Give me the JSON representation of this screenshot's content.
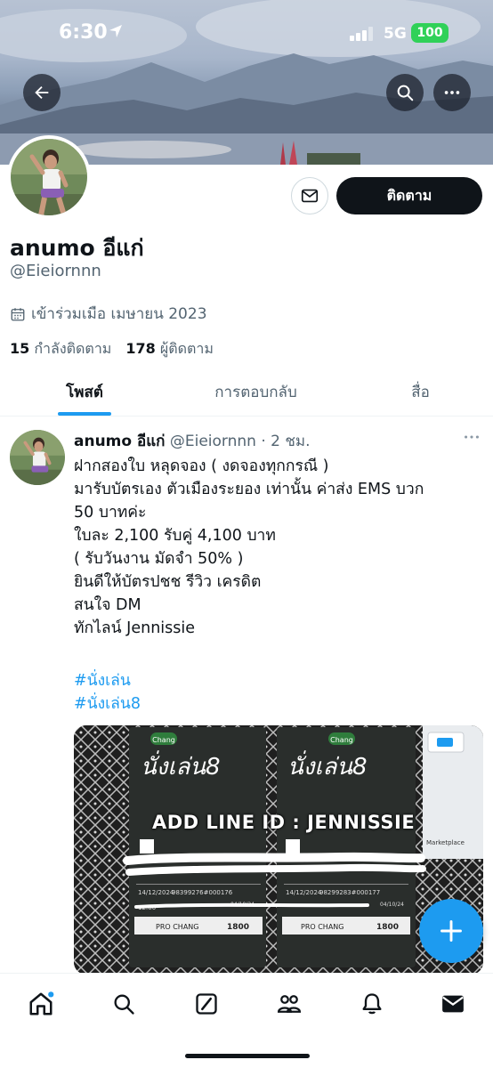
{
  "status_bar": {
    "time": "6:30",
    "network": "5G",
    "battery": "100"
  },
  "header": {
    "back_icon": "arrow-left-icon",
    "search_icon": "search-icon",
    "more_icon": "more-horizontal-icon"
  },
  "profile": {
    "display_name": "anumo อีแก่",
    "handle": "@Eieiornnn",
    "joined": "เข้าร่วมเมือ เมษายน 2023",
    "following_count": "15",
    "following_label": "กำลังติดตาม",
    "followers_count": "178",
    "followers_label": "ผู้ติดตาม",
    "follow_button": "ติดตาม"
  },
  "tabs": [
    {
      "label": "โพสต์",
      "active": true
    },
    {
      "label": "การตอบกลับ",
      "active": false
    },
    {
      "label": "สื่อ",
      "active": false
    }
  ],
  "post": {
    "name": "anumo อีแก่",
    "meta": "@Eieiornnn · 2 ชม.",
    "lines": [
      "ฝากสองใบ หลุดจอง ( งดจองทุกกรณี )",
      "มารับบัตรเอง ตัวเมืองระยอง เท่านั้น ค่าส่ง EMS บวก",
      "50 บาทค่ะ",
      "ใบละ 2,100 รับคู่ 4,100 บาท",
      "( รับวันงาน มัดจำ 50% )",
      "ยินดีให้บัตรปชช รีวิว เครดิต",
      "สนใจ DM",
      "ทักไลน์ Jennissie"
    ],
    "hashtags": [
      "#นั่งเล่น",
      "#นั่งเล่น8"
    ],
    "media_caption": "ADD LINE ID : JENNISSIE",
    "ticket_labels": {
      "brand": "Chang",
      "event": "นั่งเล่น8",
      "date": "14/12/2024",
      "time": "12:00",
      "ticket_no_left": "98399276#000176",
      "ticket_no_right": "98299283#000177",
      "issue_date": "04/10/24",
      "type": "PRO CHANG",
      "price": "1800",
      "marketplace": "Marketplace"
    }
  },
  "bottom_nav": [
    {
      "icon": "home-icon",
      "has_badge": true
    },
    {
      "icon": "search-icon"
    },
    {
      "icon": "grok-icon"
    },
    {
      "icon": "communities-icon"
    },
    {
      "icon": "notifications-icon"
    },
    {
      "icon": "messages-icon"
    }
  ],
  "colors": {
    "accent": "#1d9bf0",
    "text_primary": "#0f1419",
    "text_secondary": "#536471",
    "battery": "#30d158"
  }
}
